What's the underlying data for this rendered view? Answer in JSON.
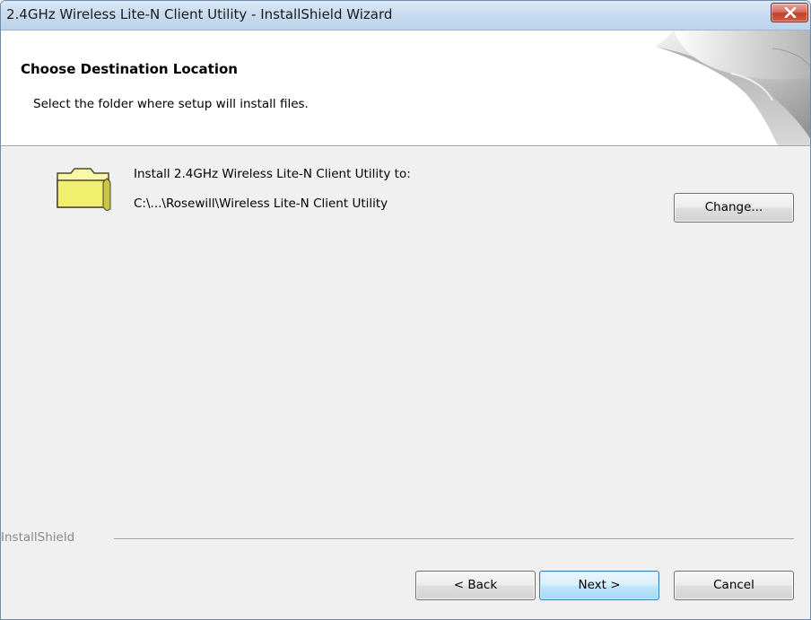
{
  "window": {
    "title": "2.4GHz Wireless Lite-N Client Utility - InstallShield Wizard",
    "close_glyph": "✕"
  },
  "header": {
    "title": "Choose Destination Location",
    "subtitle": "Select the folder where setup will install files."
  },
  "destination": {
    "label": "Install 2.4GHz Wireless Lite-N Client Utility to:",
    "path": "C:\\...\\Rosewill\\Wireless Lite-N Client Utility",
    "change_button": "Change..."
  },
  "footer": {
    "brand": "InstallShield",
    "back_button": "< Back",
    "next_button": "Next >",
    "cancel_button": "Cancel"
  },
  "icons": {
    "folder": "folder-icon",
    "close": "close-icon",
    "header_graphic": "page-curl-icon"
  },
  "colors": {
    "titlebar": "#c9dcef",
    "close_button": "#c7442f",
    "folder_fill": "#f2ee6e",
    "default_button_border": "#3c7fb1",
    "dialog_background": "#f0f0f0"
  }
}
